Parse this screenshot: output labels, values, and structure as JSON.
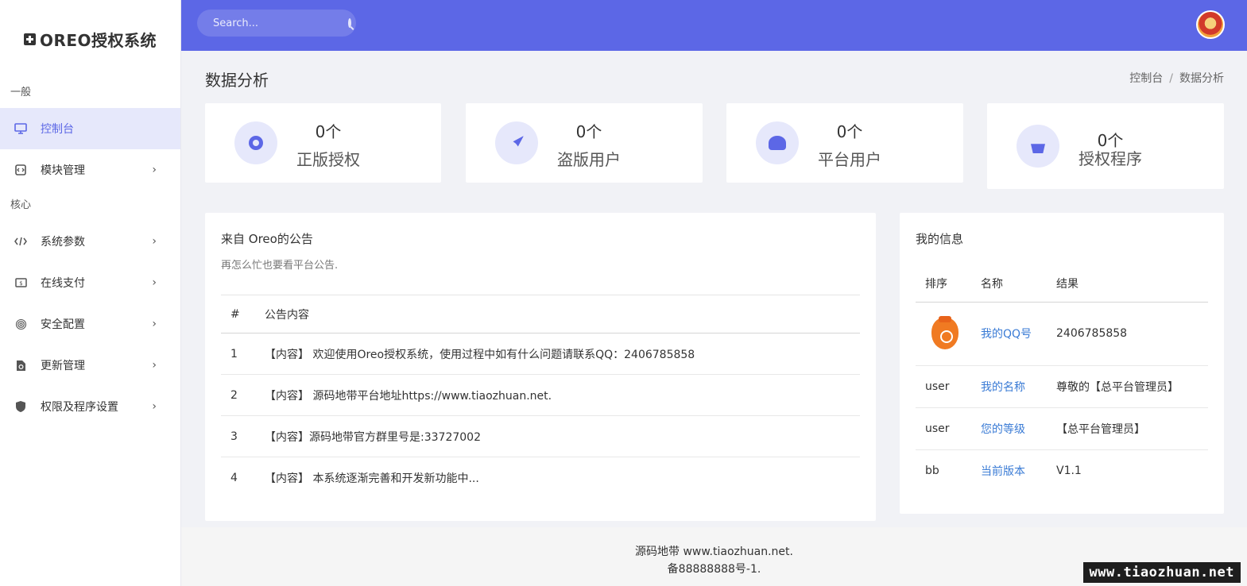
{
  "brand": {
    "title": "OREO授权系统"
  },
  "sidebar": {
    "sections": [
      {
        "label": "一般"
      },
      {
        "label": "核心"
      }
    ],
    "items": [
      {
        "label": "控制台",
        "icon": "monitor-icon",
        "active": true
      },
      {
        "label": "模块管理",
        "icon": "module-icon"
      },
      {
        "label": "系统参数",
        "icon": "code-icon"
      },
      {
        "label": "在线支付",
        "icon": "money-icon"
      },
      {
        "label": "安全配置",
        "icon": "fingerprint-icon"
      },
      {
        "label": "更新管理",
        "icon": "update-file-icon"
      },
      {
        "label": "权限及程序设置",
        "icon": "shield-icon"
      }
    ]
  },
  "header": {
    "search_placeholder": "Search..."
  },
  "page": {
    "title": "数据分析",
    "breadcrumb": [
      "控制台",
      "数据分析"
    ]
  },
  "stats": [
    {
      "value": "0个",
      "label": "正版授权",
      "icon": "webcam-icon"
    },
    {
      "value": "0个",
      "label": "盗版用户",
      "icon": "rocket-icon"
    },
    {
      "value": "0个",
      "label": "平台用户",
      "icon": "add-users-icon"
    },
    {
      "value": "0个",
      "label": "授权程序",
      "icon": "basket-icon"
    }
  ],
  "notice": {
    "title": "来自 Oreo的公告",
    "subtitle": "再怎么忙也要看平台公告.",
    "headers": [
      "#",
      "公告内容"
    ],
    "rows": [
      {
        "no": "1",
        "text": "【内容】 欢迎使用Oreo授权系统，使用过程中如有什么问题请联系QQ：2406785858"
      },
      {
        "no": "2",
        "text": "【内容】 源码地带平台地址https://www.tiaozhuan.net."
      },
      {
        "no": "3",
        "text": "【内容】源码地带官方群里号是:33727002"
      },
      {
        "no": "4",
        "text": "【内容】 本系统逐渐完善和开发新功能中..."
      }
    ]
  },
  "info": {
    "title": "我的信息",
    "headers": [
      "排序",
      "名称",
      "结果"
    ],
    "rows": [
      {
        "img": "",
        "name": "我的QQ号",
        "value": "2406785858"
      },
      {
        "img": "user",
        "name": "我的名称",
        "value": "尊敬的【总平台管理员】"
      },
      {
        "img": "user",
        "name": "您的等级",
        "value": "【总平台管理员】"
      },
      {
        "img": "bb",
        "name": "当前版本",
        "value": "V1.1"
      }
    ]
  },
  "footer": {
    "line1": "源码地带 www.tiaozhuan.net.",
    "line2": "备88888888号-1."
  },
  "watermark": "www.tiaozhuan.net",
  "colors": {
    "accent": "#5c67e6",
    "accent_light": "#e6e8fb",
    "link": "#3a7bd5"
  }
}
